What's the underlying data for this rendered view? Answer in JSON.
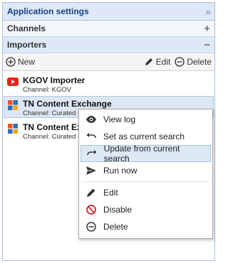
{
  "panel": {
    "title": "Application settings",
    "close_glyph": "»"
  },
  "sections": {
    "channels": {
      "label": "Channels",
      "toggle": "+"
    },
    "importers": {
      "label": "Importers",
      "toggle": "−"
    }
  },
  "toolbar": {
    "new_label": "New",
    "edit_label": "Edit",
    "delete_label": "Delete"
  },
  "importers": [
    {
      "name": "KGOV Importer",
      "channel": "Channel: KGOV",
      "icon": "youtube-icon"
    },
    {
      "name": "TN Content Exchange",
      "channel": "Channel: Curated - ",
      "icon": "windows-icon"
    },
    {
      "name": "TN Content Ex",
      "channel": "Channel: Curated - ",
      "icon": "windows-icon"
    }
  ],
  "context_menu": {
    "view_log": "View log",
    "set_current": "Set as current search",
    "update_current": "Update from current search",
    "run_now": "Run now",
    "edit": "Edit",
    "disable": "Disable",
    "delete": "Delete"
  },
  "colors": {
    "header_bg": "#dfe8f6",
    "accent": "#15428b",
    "youtube": "#e62117",
    "disable": "#cc2222"
  }
}
